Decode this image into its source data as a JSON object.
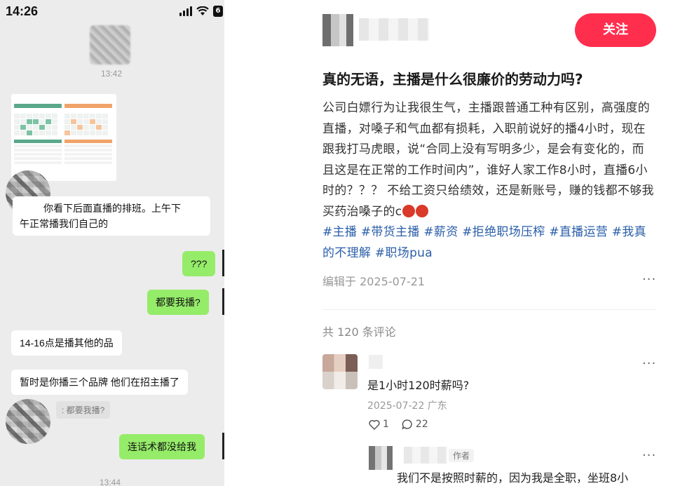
{
  "chat": {
    "status_time": "14:26",
    "battery": "6",
    "timestamp_top": "13:42",
    "timestamp_bottom": "13:44",
    "messages": [
      {
        "side": "in",
        "text_line1": "你看下后面直播的排班。上午下",
        "text_line2": "午正常播我们自己的"
      },
      {
        "side": "out",
        "text": "???"
      },
      {
        "side": "out",
        "text": "都要我播?"
      },
      {
        "side": "in",
        "text": "14-16点是播其他的品"
      },
      {
        "side": "in",
        "text": "暂时是你播三个品牌 他们在招主播了"
      },
      {
        "side": "out",
        "text": "连话术都没给我"
      }
    ],
    "quote": ": 都要我播?"
  },
  "post": {
    "follow_label": "关注",
    "title": "真的无语，主播是什么很廉价的劳动力吗?",
    "body": "公司白嫖行为让我很生气，主播跟普通工种有区别，高强度的直播，对嗓子和气血都有损耗，入职前说好的播4小时，现在跟我打马虎眼，说“合同上没有写明多少，是会有变化的，而且这是在正常的工作时间内”，谁好人家工作8小时，直播6小时的？？？ 不给工资只给绩效，还是新账号，赚的钱都不够我买药治嗓子的c",
    "tags": [
      "#主播",
      "#带货主播",
      "#薪资",
      "#拒绝职场压榨",
      "#直播运营",
      "#我真的不理解",
      "#职场pua"
    ],
    "edited": "编辑于 2025-07-21",
    "more": "···"
  },
  "comments": {
    "count_label": "共 120 条评论",
    "first": {
      "text": "是1小时120时薪吗?",
      "meta": "2025-07-22 广东",
      "likes": "1",
      "replies": "22"
    },
    "reply": {
      "badge": "作者",
      "text": "我们不是按照时薪的，因为我是全职，坐班8小"
    }
  },
  "colors": {
    "follow_button": "#ff2e4d",
    "tag": "#2a5ea8",
    "chat_out_bubble": "#95ec69",
    "chat_background": "#ececec"
  }
}
